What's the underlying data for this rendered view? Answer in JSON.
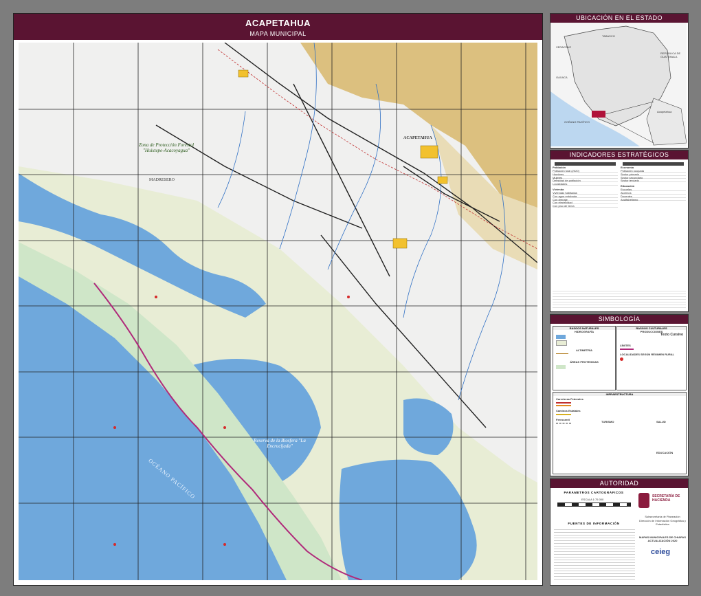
{
  "map": {
    "title": "ACAPETAHUA",
    "subtitle": "MAPA MUNICIPAL",
    "protected_area_1": "Zona de Protección Forestal \"Huixtepe-Acacoyagua\"",
    "protected_area_2": "Reserva de la Biosfera \"La Encrucijada\"",
    "place_1": "MADRESERO",
    "place_2": "ACAPETAHUA",
    "ocean_label": "OCÉANO PACÍFICO",
    "colors": {
      "header": "#5a1432",
      "ocean": "#6fa8dc",
      "coast": "#cfe6c8",
      "wetland": "#e8edd5",
      "land": "#f0f0ef",
      "mountain": "#d6b05a"
    }
  },
  "location_panel": {
    "title": "UBICACIÓN EN EL ESTADO",
    "state_labels": [
      "TABASCO",
      "VERACRUZ",
      "OAXACA",
      "REPÚBLICA DE GUATEMALA",
      "OCÉANO PACÍFICO"
    ],
    "municipio": "Acapetahua"
  },
  "indicators_panel": {
    "title": "INDICADORES ESTRATÉGICOS",
    "tables": [
      {
        "header": "Población",
        "rows": [
          "Población total (2020)",
          "Hombres",
          "Mujeres",
          "Densidad de población",
          "Localidades"
        ]
      },
      {
        "header": "Vivienda",
        "rows": [
          "Viviendas habitadas",
          "Con agua entubada",
          "Con drenaje",
          "Con electricidad",
          "Con piso de tierra"
        ]
      },
      {
        "header": "Economía",
        "rows": [
          "Población ocupada",
          "Sector primario",
          "Sector secundario",
          "Sector terciario"
        ]
      },
      {
        "header": "Educación",
        "rows": [
          "Escuelas",
          "Alumnos",
          "Docentes",
          "Analfabetismo"
        ]
      }
    ]
  },
  "symbology_panel": {
    "title": "SIMBOLOGÍA",
    "natural": "RASGOS NATURALES",
    "cultural": "RASGOS CULTURALES",
    "hydrography": "HIDROGRAFÍA",
    "altimetry": "ALTIMETRÍA",
    "protected": "ÁREAS PROTEGIDAS",
    "limits": "LÍMITES",
    "localities": "LOCALIDADES SEGÚN RÉGIMEN RURAL",
    "infrastructure": "INFRAESTRUCTURA",
    "roads": "Carreteras Federales",
    "state_roads": "Caminos Estatales",
    "rail": "Ferrocarril",
    "tourism": "TURISMO",
    "health": "SALUD",
    "education": "EDUCACIÓN",
    "sub_prod": "PRODUCCIONES",
    "text_sample": "Texto Cursivo"
  },
  "authority_panel": {
    "title": "AUTORIDAD",
    "params": "PARÁMETROS CARTOGRÁFICOS",
    "scale": "ESCALA 1:75 000",
    "sources": "FUENTES DE INFORMACIÓN",
    "org1": "SECRETARÍA DE HACIENDA",
    "org2": "Subsecretaría de Planeación",
    "org3": "Dirección de Información Geográfica y Estadística",
    "edition": "MAPAS MUNICIPALES DE CHIAPAS ACTUALIZACIÓN 2020",
    "ceieg": "ceieg"
  }
}
